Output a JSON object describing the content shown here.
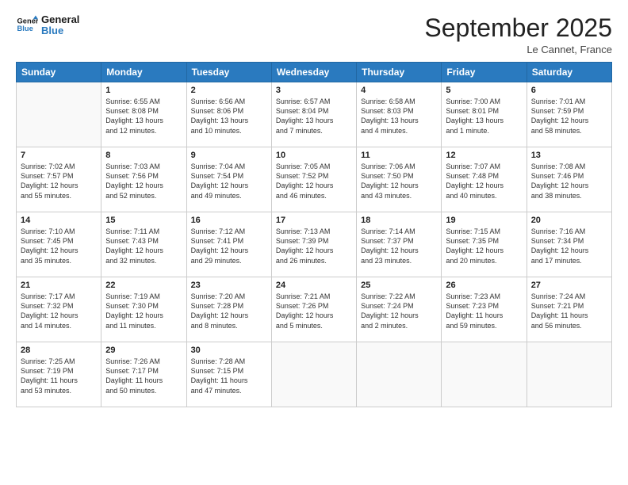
{
  "header": {
    "logo_line1": "General",
    "logo_line2": "Blue",
    "month": "September 2025",
    "location": "Le Cannet, France"
  },
  "weekdays": [
    "Sunday",
    "Monday",
    "Tuesday",
    "Wednesday",
    "Thursday",
    "Friday",
    "Saturday"
  ],
  "weeks": [
    [
      {
        "day": "",
        "info": ""
      },
      {
        "day": "1",
        "info": "Sunrise: 6:55 AM\nSunset: 8:08 PM\nDaylight: 13 hours\nand 12 minutes."
      },
      {
        "day": "2",
        "info": "Sunrise: 6:56 AM\nSunset: 8:06 PM\nDaylight: 13 hours\nand 10 minutes."
      },
      {
        "day": "3",
        "info": "Sunrise: 6:57 AM\nSunset: 8:04 PM\nDaylight: 13 hours\nand 7 minutes."
      },
      {
        "day": "4",
        "info": "Sunrise: 6:58 AM\nSunset: 8:03 PM\nDaylight: 13 hours\nand 4 minutes."
      },
      {
        "day": "5",
        "info": "Sunrise: 7:00 AM\nSunset: 8:01 PM\nDaylight: 13 hours\nand 1 minute."
      },
      {
        "day": "6",
        "info": "Sunrise: 7:01 AM\nSunset: 7:59 PM\nDaylight: 12 hours\nand 58 minutes."
      }
    ],
    [
      {
        "day": "7",
        "info": "Sunrise: 7:02 AM\nSunset: 7:57 PM\nDaylight: 12 hours\nand 55 minutes."
      },
      {
        "day": "8",
        "info": "Sunrise: 7:03 AM\nSunset: 7:56 PM\nDaylight: 12 hours\nand 52 minutes."
      },
      {
        "day": "9",
        "info": "Sunrise: 7:04 AM\nSunset: 7:54 PM\nDaylight: 12 hours\nand 49 minutes."
      },
      {
        "day": "10",
        "info": "Sunrise: 7:05 AM\nSunset: 7:52 PM\nDaylight: 12 hours\nand 46 minutes."
      },
      {
        "day": "11",
        "info": "Sunrise: 7:06 AM\nSunset: 7:50 PM\nDaylight: 12 hours\nand 43 minutes."
      },
      {
        "day": "12",
        "info": "Sunrise: 7:07 AM\nSunset: 7:48 PM\nDaylight: 12 hours\nand 40 minutes."
      },
      {
        "day": "13",
        "info": "Sunrise: 7:08 AM\nSunset: 7:46 PM\nDaylight: 12 hours\nand 38 minutes."
      }
    ],
    [
      {
        "day": "14",
        "info": "Sunrise: 7:10 AM\nSunset: 7:45 PM\nDaylight: 12 hours\nand 35 minutes."
      },
      {
        "day": "15",
        "info": "Sunrise: 7:11 AM\nSunset: 7:43 PM\nDaylight: 12 hours\nand 32 minutes."
      },
      {
        "day": "16",
        "info": "Sunrise: 7:12 AM\nSunset: 7:41 PM\nDaylight: 12 hours\nand 29 minutes."
      },
      {
        "day": "17",
        "info": "Sunrise: 7:13 AM\nSunset: 7:39 PM\nDaylight: 12 hours\nand 26 minutes."
      },
      {
        "day": "18",
        "info": "Sunrise: 7:14 AM\nSunset: 7:37 PM\nDaylight: 12 hours\nand 23 minutes."
      },
      {
        "day": "19",
        "info": "Sunrise: 7:15 AM\nSunset: 7:35 PM\nDaylight: 12 hours\nand 20 minutes."
      },
      {
        "day": "20",
        "info": "Sunrise: 7:16 AM\nSunset: 7:34 PM\nDaylight: 12 hours\nand 17 minutes."
      }
    ],
    [
      {
        "day": "21",
        "info": "Sunrise: 7:17 AM\nSunset: 7:32 PM\nDaylight: 12 hours\nand 14 minutes."
      },
      {
        "day": "22",
        "info": "Sunrise: 7:19 AM\nSunset: 7:30 PM\nDaylight: 12 hours\nand 11 minutes."
      },
      {
        "day": "23",
        "info": "Sunrise: 7:20 AM\nSunset: 7:28 PM\nDaylight: 12 hours\nand 8 minutes."
      },
      {
        "day": "24",
        "info": "Sunrise: 7:21 AM\nSunset: 7:26 PM\nDaylight: 12 hours\nand 5 minutes."
      },
      {
        "day": "25",
        "info": "Sunrise: 7:22 AM\nSunset: 7:24 PM\nDaylight: 12 hours\nand 2 minutes."
      },
      {
        "day": "26",
        "info": "Sunrise: 7:23 AM\nSunset: 7:23 PM\nDaylight: 11 hours\nand 59 minutes."
      },
      {
        "day": "27",
        "info": "Sunrise: 7:24 AM\nSunset: 7:21 PM\nDaylight: 11 hours\nand 56 minutes."
      }
    ],
    [
      {
        "day": "28",
        "info": "Sunrise: 7:25 AM\nSunset: 7:19 PM\nDaylight: 11 hours\nand 53 minutes."
      },
      {
        "day": "29",
        "info": "Sunrise: 7:26 AM\nSunset: 7:17 PM\nDaylight: 11 hours\nand 50 minutes."
      },
      {
        "day": "30",
        "info": "Sunrise: 7:28 AM\nSunset: 7:15 PM\nDaylight: 11 hours\nand 47 minutes."
      },
      {
        "day": "",
        "info": ""
      },
      {
        "day": "",
        "info": ""
      },
      {
        "day": "",
        "info": ""
      },
      {
        "day": "",
        "info": ""
      }
    ]
  ]
}
